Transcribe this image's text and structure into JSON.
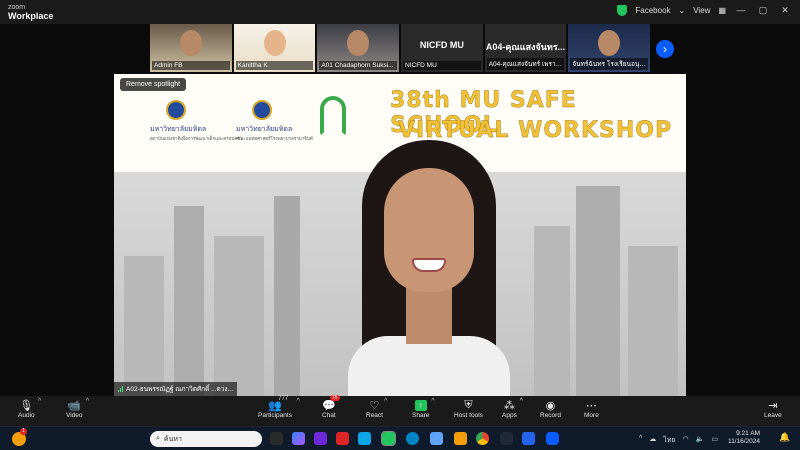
{
  "app": {
    "brand_line1": "zoom",
    "brand_line2": "Workplace"
  },
  "titlebar": {
    "share_target": "Facebook",
    "view_label": "View"
  },
  "gallery": [
    {
      "name": "Admin FB",
      "text": ""
    },
    {
      "name": "Kanittha K",
      "text": ""
    },
    {
      "name": "A01 Chadaphorn Suksi...",
      "text": ""
    },
    {
      "name": "NICFD MU",
      "text": "NICFD MU"
    },
    {
      "name": "A04-คุณแสงจันทร์ เพราะ...",
      "text": "A04-คุณแสงจันทร..."
    },
    {
      "name": "จันทร์ฉันทร โรงเรียนอนุบาล...",
      "text": ""
    }
  ],
  "spotlight": {
    "label": "Remove spotlight"
  },
  "slide": {
    "title_line1": "38th MU SAFE SCHOOL",
    "title_line2": "VIRTUAL WORKSHOP",
    "org1": "มหาวิทยาลัยมหิดล",
    "org1_sub": "สถาบันแห่งชาติเพื่อการพัฒนาเด็กและครอบครัว",
    "org2": "มหาวิทยาลัยมหิดล",
    "org2_sub": "คณะแพทยศาสตร์โรงพยาบาลรามาธิบดี"
  },
  "speaker": {
    "name": "A02-ธนพรรณัฏฐ์ ณภาวิตศักดิ์ ...ดวง..."
  },
  "toolbar": {
    "audio": "Audio",
    "video": "Video",
    "participants": "Participants",
    "participants_count": "777",
    "chat": "Chat",
    "chat_count": "75",
    "react": "React",
    "share": "Share",
    "host_tools": "Host tools",
    "apps": "Apps",
    "record": "Record",
    "more": "More",
    "leave": "Leave"
  },
  "taskbar": {
    "search_placeholder": "ค้นหา",
    "notification_count": "1",
    "lang": "ไทย",
    "time": "9:21 AM",
    "date": "11/16/2024"
  }
}
